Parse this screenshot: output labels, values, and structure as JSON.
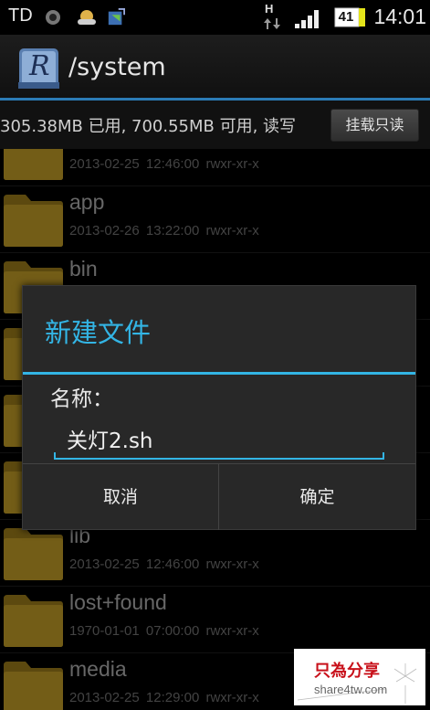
{
  "status_bar": {
    "carrier": "TD",
    "network_letter": "H",
    "battery_level": "41",
    "time": "14:01",
    "icons": [
      "sync-icon",
      "weather-icon",
      "recycle-icon",
      "signal-icon",
      "battery-icon"
    ]
  },
  "title_bar": {
    "app_icon_letter": "R",
    "path": "/system"
  },
  "storage": {
    "usage_text": "305.38MB 已用, 700.55MB 可用, 读写",
    "mount_button_label": "挂载只读"
  },
  "files": [
    {
      "name": "",
      "meta": "2013-02-25 12:46:00  rwxr-xr-x"
    },
    {
      "name": "app",
      "meta": "2013-02-26 13:22:00  rwxr-xr-x"
    },
    {
      "name": "bin",
      "meta": ""
    },
    {
      "name": "",
      "meta": ""
    },
    {
      "name": "",
      "meta": ""
    },
    {
      "name": "",
      "meta": ""
    },
    {
      "name": "lib",
      "meta": "2013-02-25 12:46:00  rwxr-xr-x"
    },
    {
      "name": "lost+found",
      "meta": "1970-01-01 07:00:00  rwxr-xr-x"
    },
    {
      "name": "media",
      "meta": "2013-02-25 12:29:00  rwxr-xr-x"
    }
  ],
  "dialog": {
    "title": "新建文件",
    "name_label": "名称：",
    "name_value": "关灯2.sh",
    "cancel_label": "取消",
    "ok_label": "确定"
  },
  "watermark": {
    "title": "只為分享",
    "subtitle": "share4tw.com"
  },
  "colors": {
    "accent": "#33b5e5",
    "folder": "#c9a227",
    "title_underline": "#2b7bb5",
    "watermark_red": "#c8101a"
  }
}
